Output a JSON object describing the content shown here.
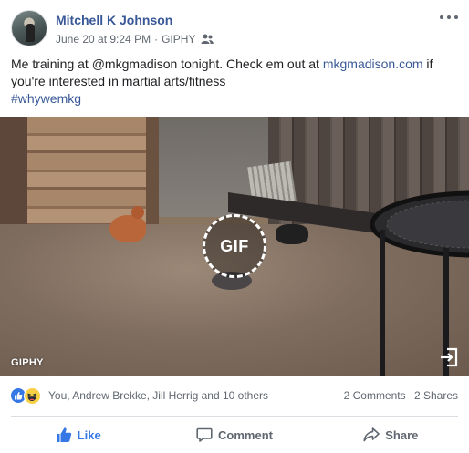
{
  "post": {
    "author": "Mitchell K Johnson",
    "date": "June 20 at 9:24 PM",
    "via": "GIPHY",
    "audience_icon": "friends-icon",
    "text_parts": {
      "p1": "Me training at @mkgmadison tonight. Check em out at ",
      "link": "mkgmadison.com",
      "p2": " if you're interested in martial arts/fitness",
      "hashtag": "#whywemkg"
    }
  },
  "media": {
    "badge": "GIF",
    "source_label": "GIPHY",
    "expand_icon": "expand-icon"
  },
  "reactions": {
    "icons": [
      "like-icon",
      "haha-icon"
    ],
    "names": "You, Andrew Brekke, Jill Herrig and 10 others",
    "comments": "2 Comments",
    "shares": "2 Shares"
  },
  "actions": {
    "like": "Like",
    "comment": "Comment",
    "share": "Share"
  },
  "colors": {
    "link": "#385898",
    "like_active": "#3578e5",
    "muted": "#606770"
  }
}
